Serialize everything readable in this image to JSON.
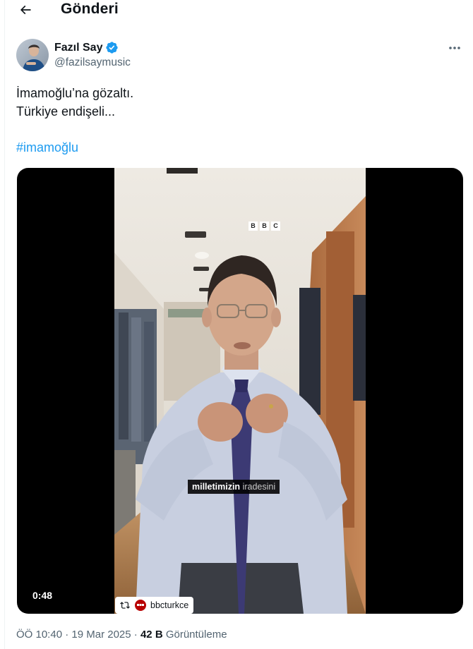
{
  "header": {
    "title": "Gönderi"
  },
  "author": {
    "name": "Fazıl Say",
    "handle": "@fazilsaymusic"
  },
  "tweet": {
    "line1": "İmamoğlu’na gözaltı.",
    "line2": "Türkiye endişeli...",
    "hashtag": "#imamoğlu"
  },
  "media": {
    "watermark": "BBC",
    "subtitle_bold": "milletimizin",
    "subtitle_rest": "iradesini",
    "duration": "0:48",
    "source": "bbcturkce"
  },
  "meta": {
    "time": "ÖÖ 10:40",
    "separator": "·",
    "date": "19 Mar 2025",
    "views_count": "42 B",
    "views_label": "Görüntüleme"
  },
  "colors": {
    "link": "#1d9bf0",
    "verified": "#1d9bf0",
    "secondary_text": "#536471"
  }
}
